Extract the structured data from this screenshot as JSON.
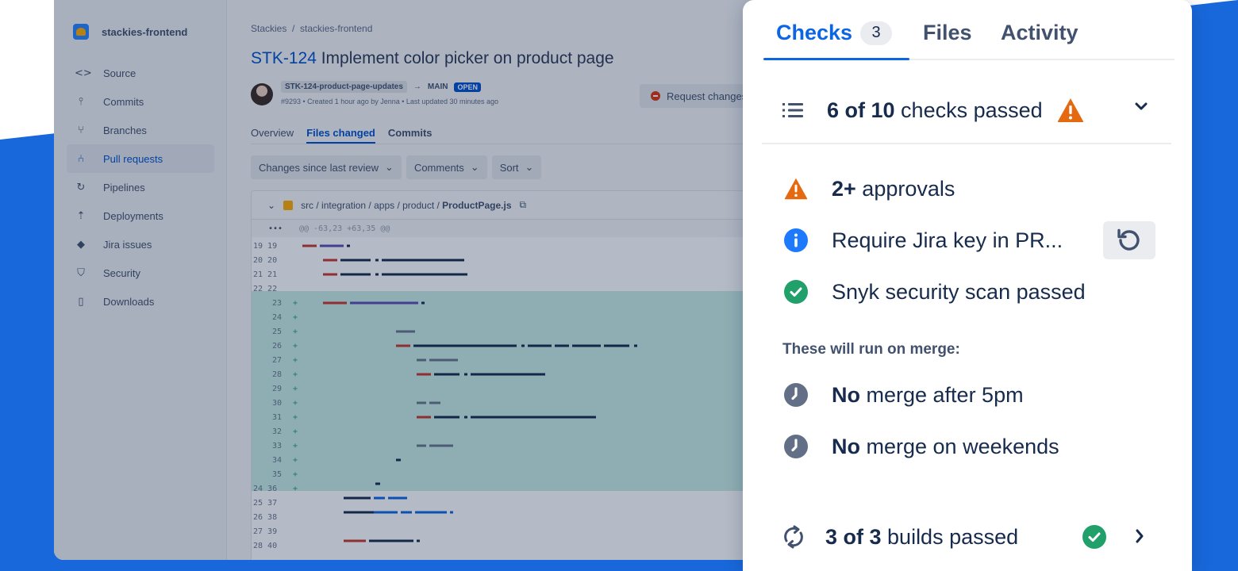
{
  "colors": {
    "brand_blue": "#1868db",
    "link_blue": "#0c66e4",
    "warning": "#e56910",
    "info": "#1d7afc",
    "success": "#22a06b",
    "neutral_icon": "#626f86"
  },
  "sidebar": {
    "repo_name": "stackies-frontend",
    "items": [
      {
        "label": "Source",
        "icon": "code-icon"
      },
      {
        "label": "Commits",
        "icon": "commit-icon"
      },
      {
        "label": "Branches",
        "icon": "branch-icon"
      },
      {
        "label": "Pull requests",
        "icon": "pull-request-icon",
        "active": true
      },
      {
        "label": "Pipelines",
        "icon": "pipelines-icon"
      },
      {
        "label": "Deployments",
        "icon": "deployments-icon"
      },
      {
        "label": "Jira issues",
        "icon": "jira-icon"
      },
      {
        "label": "Security",
        "icon": "shield-icon"
      },
      {
        "label": "Downloads",
        "icon": "file-icon"
      }
    ]
  },
  "pr": {
    "breadcrumb": "Stackies  /  stackies-frontend",
    "key": "STK-124",
    "title": "Implement color picker on product page",
    "source_branch": "STK-124-product-page-updates",
    "arrow": "→",
    "target_branch": "MAIN",
    "status": "OPEN",
    "meta": "#9293 • Created 1 hour ago by Jenna • Last updated 30 minutes ago",
    "request_changes": "Request changes",
    "tabs": [
      "Overview",
      "Files changed",
      "Commits"
    ],
    "filters": [
      "Changes since last review",
      "Comments",
      "Sort"
    ],
    "file_path_prefix": "src / integration / apps / product / ",
    "file_name": "ProductPage.js",
    "hunk_dots": "•••",
    "hunk_header": "@@ -63,23 +63,35 @@"
  },
  "panel": {
    "tabs": {
      "checks": "Checks",
      "checks_count": "3",
      "files": "Files",
      "activity": "Activity"
    },
    "summary": {
      "passed_bold": "6 of 10",
      "passed_rest": " checks passed"
    },
    "checks": [
      {
        "bold": "2+",
        "text": " approvals",
        "status": "warning"
      },
      {
        "bold": "",
        "text": "Require Jira key in PR...",
        "status": "info"
      },
      {
        "bold": "",
        "text": "Snyk security scan passed",
        "status": "success"
      }
    ],
    "on_merge_label": "These will run on merge:",
    "merge_checks": [
      {
        "bold": "No",
        "text": " merge after 5pm",
        "status": "pending"
      },
      {
        "bold": "No",
        "text": " merge on weekends",
        "status": "pending"
      }
    ],
    "builds": {
      "bold": "3 of 3",
      "text": " builds passed"
    }
  }
}
